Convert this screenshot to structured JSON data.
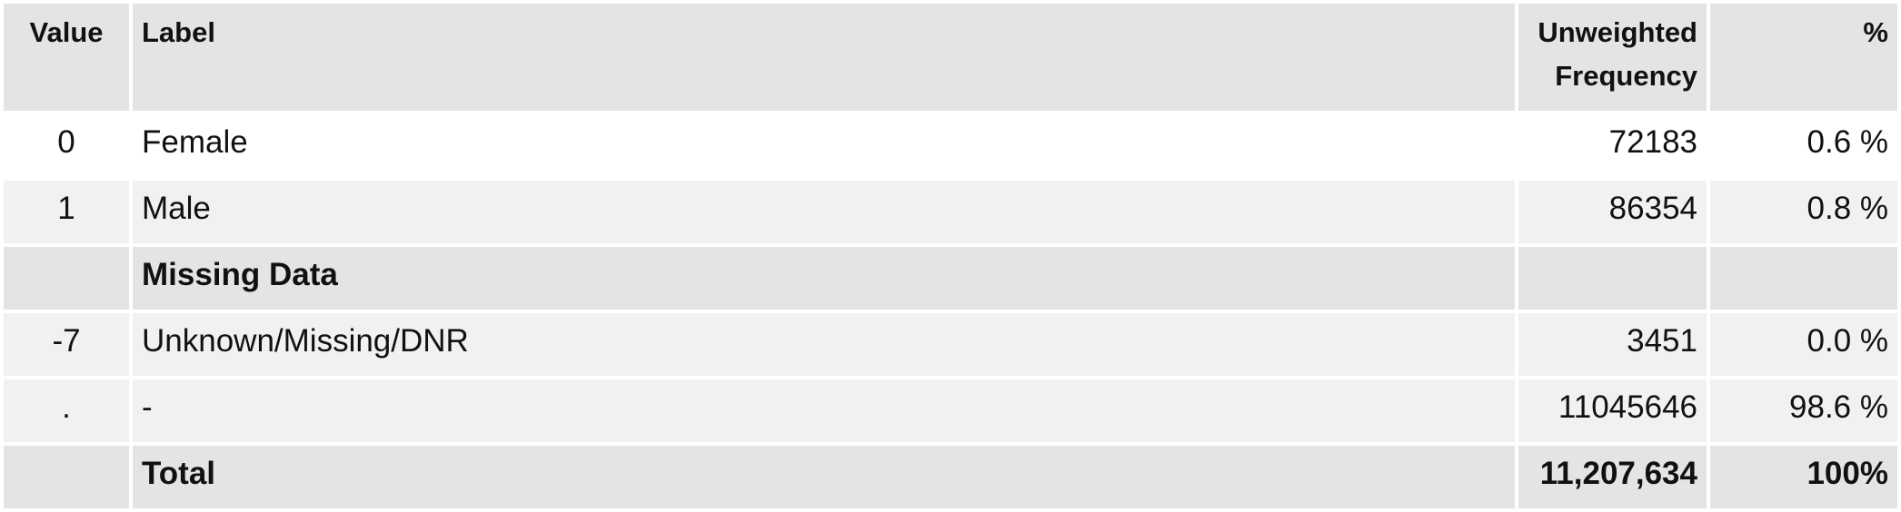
{
  "headers": {
    "value": "Value",
    "label": "Label",
    "freq_line1": "Unweighted",
    "freq_line2": "Frequency",
    "pct": "%"
  },
  "rows": [
    {
      "value": "0",
      "label": "Female",
      "freq": "72183",
      "pct": "0.6 %"
    },
    {
      "value": "1",
      "label": "Male",
      "freq": "86354",
      "pct": "0.8 %"
    }
  ],
  "missing_section": {
    "label": "Missing Data"
  },
  "missing_rows": [
    {
      "value": "-7",
      "label": "Unknown/Missing/DNR",
      "freq": "3451",
      "pct": "0.0 %"
    },
    {
      "value": ".",
      "label": "-",
      "freq": "11045646",
      "pct": "98.6 %"
    }
  ],
  "total": {
    "label": "Total",
    "freq": "11,207,634",
    "pct": "100%"
  }
}
